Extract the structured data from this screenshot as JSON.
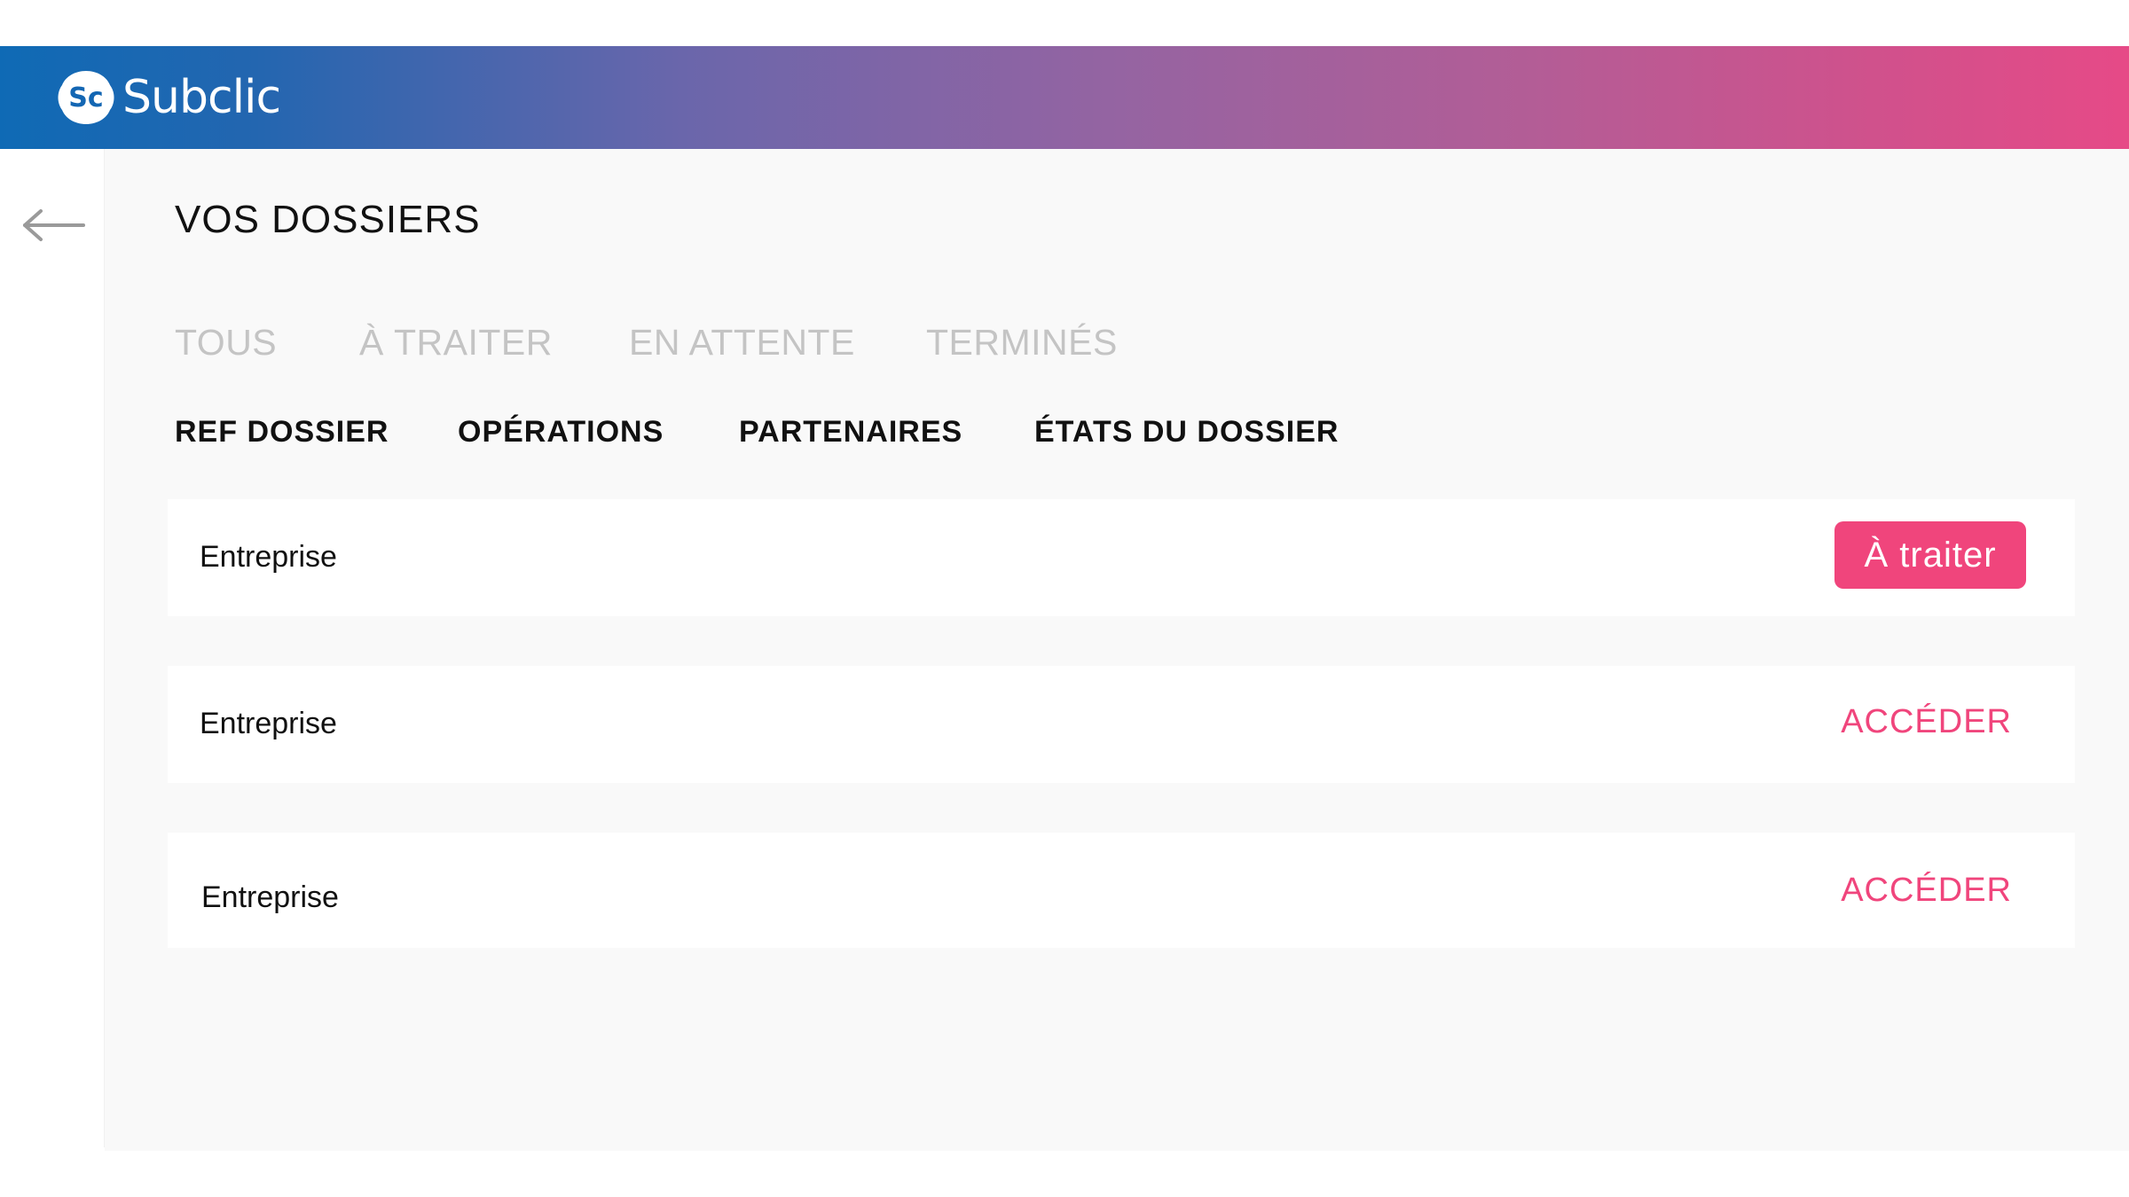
{
  "brand": {
    "name": "Subclic",
    "colors": {
      "gradient_start": "#0f6ab5",
      "gradient_end": "#e64a87",
      "accent": "#f0457c"
    }
  },
  "navigation": {
    "back_icon": "arrow-left-icon"
  },
  "page": {
    "title": "VOS DOSSIERS"
  },
  "filters": {
    "tabs": [
      {
        "label": "TOUS"
      },
      {
        "label": "À TRAITER"
      },
      {
        "label": "EN ATTENTE"
      },
      {
        "label": "TERMINÉS"
      }
    ]
  },
  "columns": {
    "headers": [
      {
        "label": "REF DOSSIER"
      },
      {
        "label": "OPÉRATIONS"
      },
      {
        "label": "PARTENAIRES"
      },
      {
        "label": "ÉTATS DU DOSSIER"
      }
    ]
  },
  "rows": [
    {
      "label": "Entreprise",
      "action": "À traiter"
    },
    {
      "label": "Entreprise",
      "action": "ACCÉDER"
    },
    {
      "label": "Entreprise",
      "action": "ACCÉDER"
    }
  ]
}
